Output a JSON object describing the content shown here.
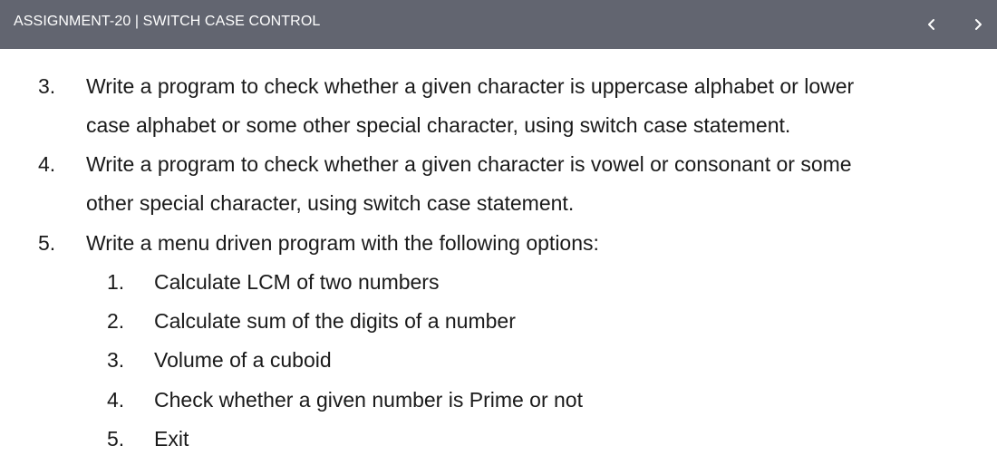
{
  "header": {
    "title": "ASSIGNMENT-20 | SWITCH CASE CONTROL",
    "prev_icon": "chevron-left-icon",
    "next_icon": "chevron-right-icon"
  },
  "questions": [
    {
      "number": "3.",
      "lines": [
        "Write a program to check whether a given character is uppercase alphabet or lower",
        "case alphabet or some other special character, using switch case statement."
      ]
    },
    {
      "number": "4.",
      "lines": [
        "Write a program to check whether a given character is vowel or consonant or some",
        "other special character, using switch case statement."
      ]
    },
    {
      "number": "5.",
      "lines": [
        "Write a menu driven program with the following options:"
      ],
      "options": [
        {
          "number": "1.",
          "text": "Calculate LCM of two numbers"
        },
        {
          "number": "2.",
          "text": "Calculate sum of the digits of a number"
        },
        {
          "number": "3.",
          "text": "Volume of a cuboid"
        },
        {
          "number": "4.",
          "text": "Check whether a given number is Prime or not"
        },
        {
          "number": "5.",
          "text": "Exit"
        }
      ]
    }
  ]
}
